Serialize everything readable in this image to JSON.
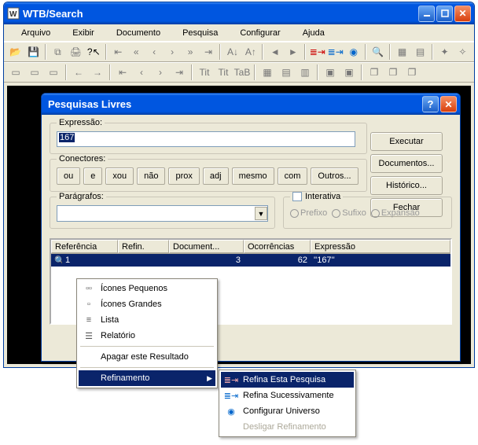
{
  "window": {
    "title": "WTB/Search",
    "menus": {
      "arquivo": "Arquivo",
      "exibir": "Exibir",
      "documento": "Documento",
      "pesquisa": "Pesquisa",
      "configurar": "Configurar",
      "ajuda": "Ajuda"
    }
  },
  "dialog": {
    "title": "Pesquisas Livres",
    "expr_label": "Expressão:",
    "expr_value": "167",
    "conn_label": "Conectores:",
    "connectors": {
      "ou": "ou",
      "e": "e",
      "xou": "xou",
      "nao": "não",
      "prox": "prox",
      "adj": "adj",
      "mesmo": "mesmo",
      "com": "com",
      "outros": "Outros..."
    },
    "buttons": {
      "executar": "Executar",
      "documentos": "Documentos...",
      "historico": "Histórico...",
      "fechar": "Fechar"
    },
    "paragraphs_label": "Parágrafos:",
    "interativa": {
      "label": "Interativa",
      "prefixo": "Prefixo",
      "sufixo": "Sufixo",
      "expansao": "Expansão"
    },
    "columns": {
      "ref": "Referência",
      "refin": "Refin.",
      "doc": "Document...",
      "ocorr": "Ocorrências",
      "expr": "Expressão"
    },
    "row": {
      "ref": "1",
      "refin": "",
      "doc": "3",
      "ocorr": "62",
      "expr": "''167''"
    }
  },
  "ctx1": {
    "icones_peq": "Ícones Pequenos",
    "icones_grd": "Ícones Grandes",
    "lista": "Lista",
    "relatorio": "Relatório",
    "apagar": "Apagar este Resultado",
    "refinamento": "Refinamento"
  },
  "ctx2": {
    "refina_esta": "Refina Esta Pesquisa",
    "refina_suc": "Refina Sucessivamente",
    "config_univ": "Configurar Universo",
    "desligar": "Desligar Refinamento"
  }
}
